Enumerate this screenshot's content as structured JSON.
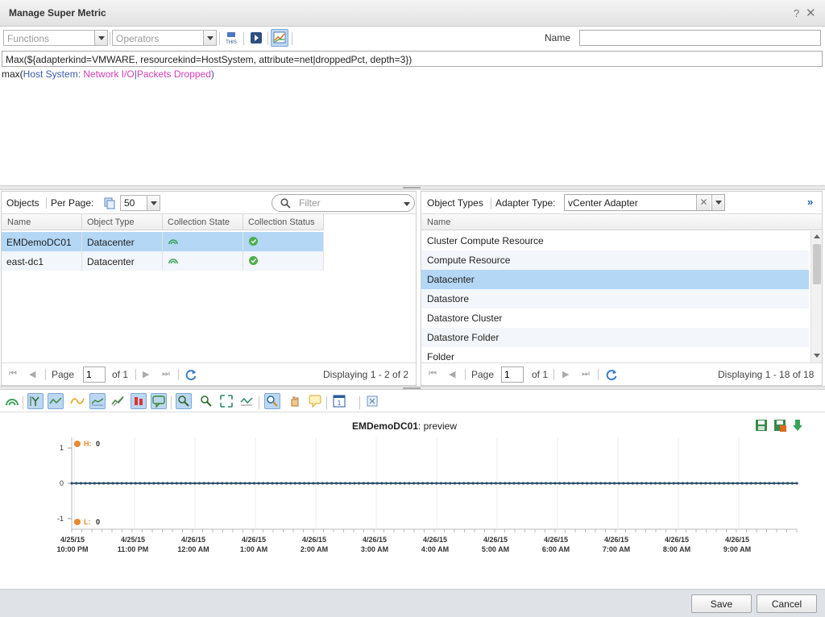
{
  "dialog": {
    "title": "Manage Super Metric",
    "help_label": "?",
    "close_label": "✕"
  },
  "toolbar": {
    "functions_placeholder": "Functions",
    "operators_placeholder": "Operators",
    "this_icon_label": "THIS",
    "name_label": "Name",
    "name_value": ""
  },
  "formula": {
    "expression": "Max(${adapterkind=VMWARE, resourcekind=HostSystem, attribute=net|droppedPct, depth=3})",
    "readable_prefix": "max(",
    "readable_kind": "Host System:",
    "readable_attr_a": " Network I/O",
    "readable_sep": "|",
    "readable_attr_b": "Packets Dropped",
    "readable_suffix": ")"
  },
  "objects_panel": {
    "label": "Objects",
    "per_page_label": "Per Page:",
    "per_page_value": "50",
    "filter_placeholder": "Filter",
    "columns": [
      "Name",
      "Object Type",
      "Collection State",
      "Collection Status"
    ],
    "rows": [
      {
        "name": "EMDemoDC01",
        "type": "Datacenter",
        "selected": true
      },
      {
        "name": "east-dc1",
        "type": "Datacenter",
        "selected": false
      }
    ],
    "pager": {
      "page_label": "Page",
      "page_value": "1",
      "of_label": "of 1",
      "display": "Displaying 1 - 2 of 2"
    }
  },
  "types_panel": {
    "label": "Object Types",
    "adapter_label": "Adapter Type:",
    "adapter_value": "vCenter Adapter",
    "more_label": "»",
    "column": "Name",
    "items": [
      {
        "label": "Cluster Compute Resource",
        "selected": false
      },
      {
        "label": "Compute Resource",
        "selected": false
      },
      {
        "label": "Datacenter",
        "selected": true
      },
      {
        "label": "Datastore",
        "selected": false
      },
      {
        "label": "Datastore Cluster",
        "selected": false
      },
      {
        "label": "Datastore Folder",
        "selected": false
      },
      {
        "label": "Folder",
        "selected": false
      }
    ],
    "pager": {
      "page_label": "Page",
      "page_value": "1",
      "of_label": "of 1",
      "display": "Displaying 1 - 18 of 18"
    }
  },
  "preview": {
    "title_bold": "EMDemoDC01",
    "title_rest": ": preview",
    "high_label": "H:",
    "high_value": "0",
    "low_label": "L:",
    "low_value": "0"
  },
  "chart_data": {
    "type": "line",
    "ylim": [
      -1.3,
      1.3
    ],
    "yticks": [
      "1",
      "0",
      "-1"
    ],
    "x_ticks": [
      {
        "date": "4/25/15",
        "time": "10:00 PM"
      },
      {
        "date": "4/25/15",
        "time": "11:00 PM"
      },
      {
        "date": "4/26/15",
        "time": "12:00 AM"
      },
      {
        "date": "4/26/15",
        "time": "1:00 AM"
      },
      {
        "date": "4/26/15",
        "time": "2:00 AM"
      },
      {
        "date": "4/26/15",
        "time": "3:00 AM"
      },
      {
        "date": "4/26/15",
        "time": "4:00 AM"
      },
      {
        "date": "4/26/15",
        "time": "5:00 AM"
      },
      {
        "date": "4/26/15",
        "time": "6:00 AM"
      },
      {
        "date": "4/26/15",
        "time": "7:00 AM"
      },
      {
        "date": "4/26/15",
        "time": "8:00 AM"
      },
      {
        "date": "4/26/15",
        "time": "9:00 AM"
      }
    ],
    "series": [
      {
        "values_constant": 0,
        "point_count": 160
      }
    ],
    "grid": true,
    "colors": {
      "line": "#3d5f78",
      "marker": "#e88a2e"
    }
  },
  "footer": {
    "save_label": "Save",
    "cancel_label": "Cancel"
  }
}
